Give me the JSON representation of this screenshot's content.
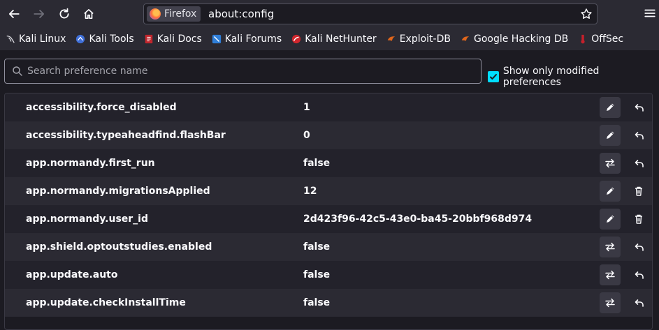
{
  "browser": {
    "identity_label": "Firefox",
    "url": "about:config"
  },
  "bookmarks": [
    {
      "label": "Kali Linux",
      "icon": "kali-dragon-icon"
    },
    {
      "label": "Kali Tools",
      "icon": "kali-tools-icon"
    },
    {
      "label": "Kali Docs",
      "icon": "kali-docs-icon"
    },
    {
      "label": "Kali Forums",
      "icon": "kali-forums-icon"
    },
    {
      "label": "Kali NetHunter",
      "icon": "nethunter-icon"
    },
    {
      "label": "Exploit-DB",
      "icon": "exploit-db-icon"
    },
    {
      "label": "Google Hacking DB",
      "icon": "ghdb-icon"
    },
    {
      "label": "OffSec",
      "icon": "offsec-icon"
    }
  ],
  "search": {
    "placeholder": "Search preference name",
    "modified_label": "Show only modified preferences",
    "modified_checked": true
  },
  "prefs": [
    {
      "name": "accessibility.force_disabled",
      "value": "1",
      "primary": "edit",
      "secondary": "reset"
    },
    {
      "name": "accessibility.typeaheadfind.flashBar",
      "value": "0",
      "primary": "edit",
      "secondary": "reset"
    },
    {
      "name": "app.normandy.first_run",
      "value": "false",
      "primary": "toggle",
      "secondary": "reset"
    },
    {
      "name": "app.normandy.migrationsApplied",
      "value": "12",
      "primary": "edit",
      "secondary": "delete"
    },
    {
      "name": "app.normandy.user_id",
      "value": "2d423f96-42c5-43e0-ba45-20bbf968d974",
      "primary": "edit",
      "secondary": "delete"
    },
    {
      "name": "app.shield.optoutstudies.enabled",
      "value": "false",
      "primary": "toggle",
      "secondary": "reset"
    },
    {
      "name": "app.update.auto",
      "value": "false",
      "primary": "toggle",
      "secondary": "reset"
    },
    {
      "name": "app.update.checkInstallTime",
      "value": "false",
      "primary": "toggle",
      "secondary": "reset"
    }
  ],
  "colors": {
    "accent": "#00ddff",
    "background": "#1c1b22",
    "toolbar": "#2b2a33"
  }
}
